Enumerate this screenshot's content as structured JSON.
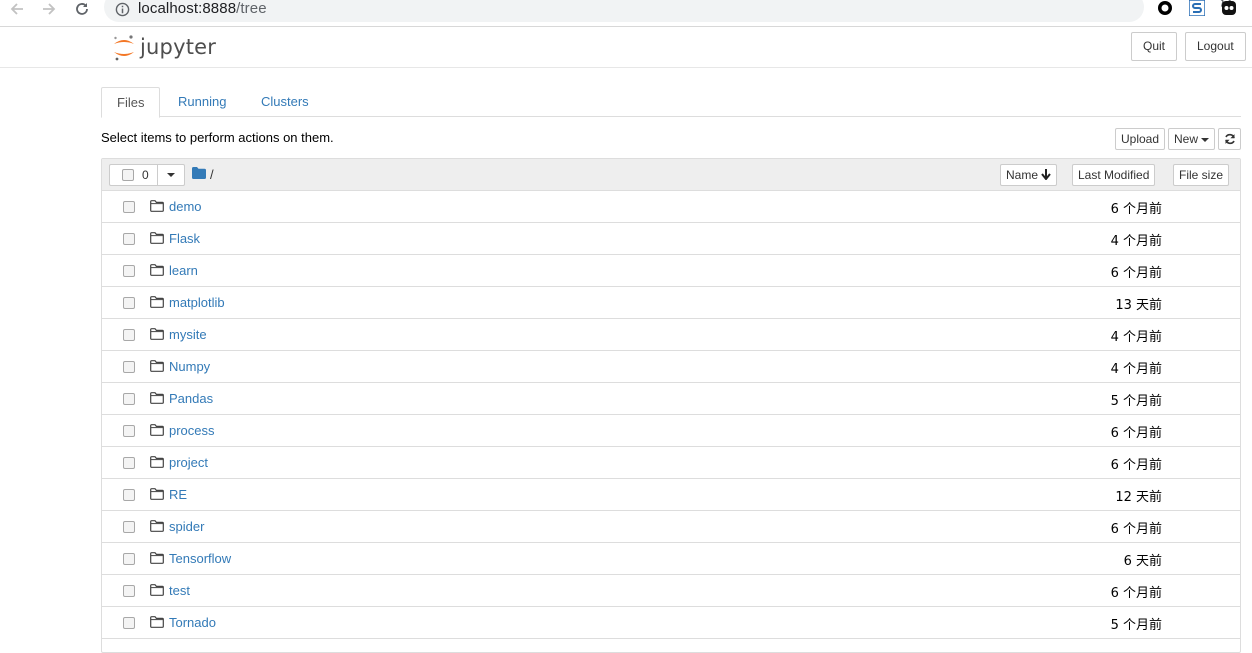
{
  "browser": {
    "url_host": "localhost:8888",
    "url_path": "/tree"
  },
  "header": {
    "logo_text": "jupyter",
    "quit_label": "Quit",
    "logout_label": "Logout"
  },
  "tabs": [
    {
      "label": "Files",
      "active": true
    },
    {
      "label": "Running",
      "active": false
    },
    {
      "label": "Clusters",
      "active": false
    }
  ],
  "toolbar": {
    "hint": "Select items to perform actions on them.",
    "upload_label": "Upload",
    "new_label": "New"
  },
  "list": {
    "selected_count": "0",
    "breadcrumb": "/",
    "sort_name_label": "Name",
    "sort_modified_label": "Last Modified",
    "sort_size_label": "File size",
    "items": [
      {
        "name": "demo",
        "modified": "6 个月前"
      },
      {
        "name": "Flask",
        "modified": "4 个月前"
      },
      {
        "name": "learn",
        "modified": "6 个月前"
      },
      {
        "name": "matplotlib",
        "modified": "13 天前"
      },
      {
        "name": "mysite",
        "modified": "4 个月前"
      },
      {
        "name": "Numpy",
        "modified": "4 个月前"
      },
      {
        "name": "Pandas",
        "modified": "5 个月前"
      },
      {
        "name": "process",
        "modified": "6 个月前"
      },
      {
        "name": "project",
        "modified": "6 个月前"
      },
      {
        "name": "RE",
        "modified": "12 天前"
      },
      {
        "name": "spider",
        "modified": "6 个月前"
      },
      {
        "name": "Tensorflow",
        "modified": "6 天前"
      },
      {
        "name": "test",
        "modified": "6 个月前"
      },
      {
        "name": "Tornado",
        "modified": "5 个月前"
      }
    ]
  },
  "colors": {
    "link": "#337ab7",
    "jupyter_orange": "#f37726",
    "header_bg": "#eeeeee"
  },
  "icons": {
    "back": "arrow-left-icon",
    "forward": "arrow-right-icon",
    "reload": "reload-icon",
    "info": "info-icon",
    "star": "star-icon",
    "folder": "folder-icon",
    "refresh": "refresh-icon"
  }
}
